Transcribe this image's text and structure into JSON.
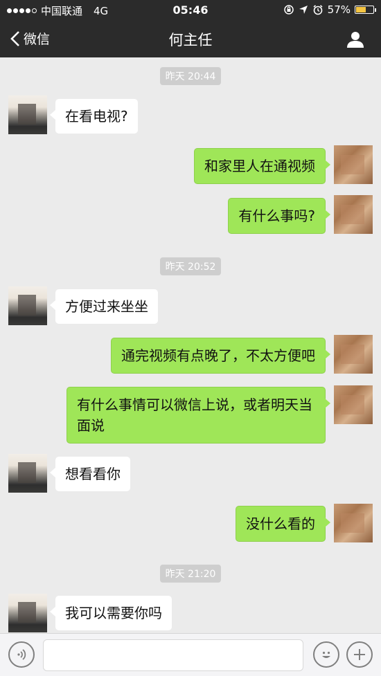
{
  "status_bar": {
    "carrier": "中国联通",
    "network": "4G",
    "time": "05:46",
    "battery": "57%",
    "battery_level": 0.57
  },
  "nav": {
    "back_label": "微信",
    "title": "何主任"
  },
  "chat": {
    "timestamps": [
      "昨天 20:44",
      "昨天 20:52",
      "昨天 21:20"
    ],
    "messages": [
      {
        "side": "left",
        "text": "在看电视?"
      },
      {
        "side": "right",
        "text": "和家里人在通视频"
      },
      {
        "side": "right",
        "text": "有什么事吗?"
      },
      {
        "side": "left",
        "text": "方便过来坐坐"
      },
      {
        "side": "right",
        "text": "通完视频有点晚了，不太方便吧"
      },
      {
        "side": "right",
        "text": "有什么事情可以微信上说，或者明天当面说"
      },
      {
        "side": "left",
        "text": "想看看你"
      },
      {
        "side": "right",
        "text": "没什么看的"
      },
      {
        "side": "left",
        "text": "我可以需要你吗"
      }
    ]
  },
  "colors": {
    "bar_bg": "#2b2b2b",
    "chat_bg": "#ebebeb",
    "sent_bubble": "#9fe658",
    "received_bubble": "#ffffff"
  }
}
